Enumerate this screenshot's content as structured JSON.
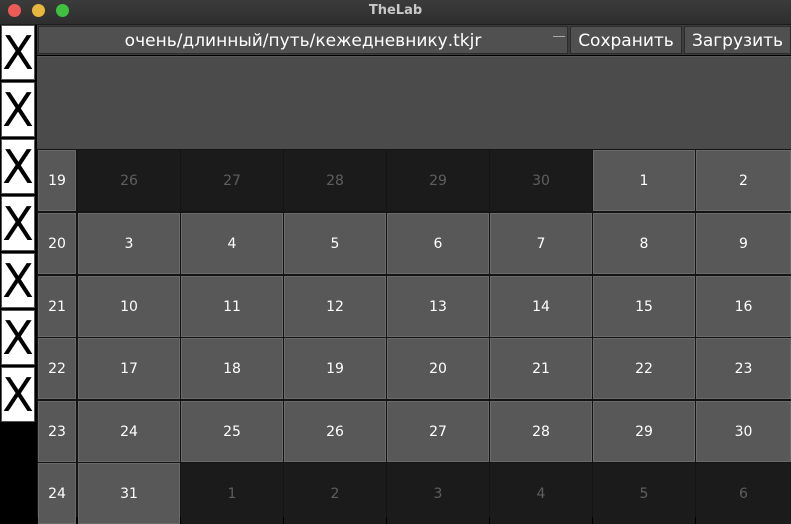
{
  "window": {
    "title": "TheLab"
  },
  "sidebar": {
    "buttons": [
      "X",
      "X",
      "X",
      "X",
      "X",
      "X",
      "X"
    ]
  },
  "toolbar": {
    "path_value": "очень/длинный/путь/кежедневнику.tkjr",
    "save_label": "Сохранить",
    "load_label": "Загрузить"
  },
  "calendar": {
    "rows": [
      {
        "week": "19",
        "days": [
          {
            "d": "26",
            "cur": false
          },
          {
            "d": "27",
            "cur": false
          },
          {
            "d": "28",
            "cur": false
          },
          {
            "d": "29",
            "cur": false
          },
          {
            "d": "30",
            "cur": false
          },
          {
            "d": "1",
            "cur": true
          },
          {
            "d": "2",
            "cur": true
          }
        ]
      },
      {
        "week": "20",
        "days": [
          {
            "d": "3",
            "cur": true
          },
          {
            "d": "4",
            "cur": true
          },
          {
            "d": "5",
            "cur": true
          },
          {
            "d": "6",
            "cur": true
          },
          {
            "d": "7",
            "cur": true
          },
          {
            "d": "8",
            "cur": true
          },
          {
            "d": "9",
            "cur": true
          }
        ]
      },
      {
        "week": "21",
        "days": [
          {
            "d": "10",
            "cur": true
          },
          {
            "d": "11",
            "cur": true
          },
          {
            "d": "12",
            "cur": true
          },
          {
            "d": "13",
            "cur": true
          },
          {
            "d": "14",
            "cur": true
          },
          {
            "d": "15",
            "cur": true
          },
          {
            "d": "16",
            "cur": true
          }
        ]
      },
      {
        "week": "22",
        "days": [
          {
            "d": "17",
            "cur": true
          },
          {
            "d": "18",
            "cur": true
          },
          {
            "d": "19",
            "cur": true
          },
          {
            "d": "20",
            "cur": true
          },
          {
            "d": "21",
            "cur": true
          },
          {
            "d": "22",
            "cur": true
          },
          {
            "d": "23",
            "cur": true
          }
        ]
      },
      {
        "week": "23",
        "days": [
          {
            "d": "24",
            "cur": true
          },
          {
            "d": "25",
            "cur": true
          },
          {
            "d": "26",
            "cur": true
          },
          {
            "d": "27",
            "cur": true
          },
          {
            "d": "28",
            "cur": true
          },
          {
            "d": "29",
            "cur": true
          },
          {
            "d": "30",
            "cur": true
          }
        ]
      },
      {
        "week": "24",
        "days": [
          {
            "d": "31",
            "cur": true
          },
          {
            "d": "1",
            "cur": false
          },
          {
            "d": "2",
            "cur": false
          },
          {
            "d": "3",
            "cur": false
          },
          {
            "d": "4",
            "cur": false
          },
          {
            "d": "5",
            "cur": false
          },
          {
            "d": "6",
            "cur": false
          }
        ]
      }
    ]
  }
}
